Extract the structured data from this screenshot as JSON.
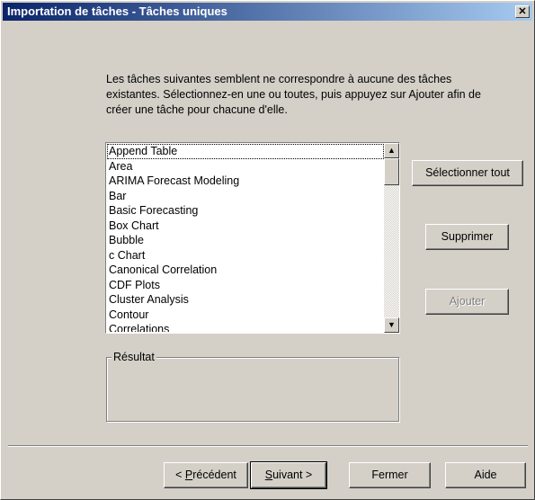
{
  "window": {
    "title": "Importation de tâches - Tâches uniques",
    "close_glyph": "✕"
  },
  "intro": {
    "text": "Les tâches suivantes semblent ne correspondre à aucune des tâches existantes. Sélectionnez-en une ou toutes, puis appuyez sur Ajouter afin de créer une tâche pour chacune d'elle."
  },
  "task_list": {
    "items": [
      "Append Table",
      "Area",
      "ARIMA Forecast Modeling",
      "Bar",
      "Basic Forecasting",
      "Box Chart",
      "Bubble",
      "c Chart",
      "Canonical Correlation",
      "CDF Plots",
      "Cluster Analysis",
      "Contour",
      "Correlations"
    ],
    "scroll_up_glyph": "▲",
    "scroll_down_glyph": "▼"
  },
  "side_buttons": {
    "select_all": "Sélectionner tout",
    "delete": "Supprimer",
    "add": "Ajouter"
  },
  "result_group": {
    "label": "Résultat"
  },
  "footer": {
    "previous_prefix": "< ",
    "previous_mnemonic": "P",
    "previous_rest": "récédent",
    "next_mnemonic": "S",
    "next_rest": "uivant >",
    "close": "Fermer",
    "help": "Aide"
  }
}
